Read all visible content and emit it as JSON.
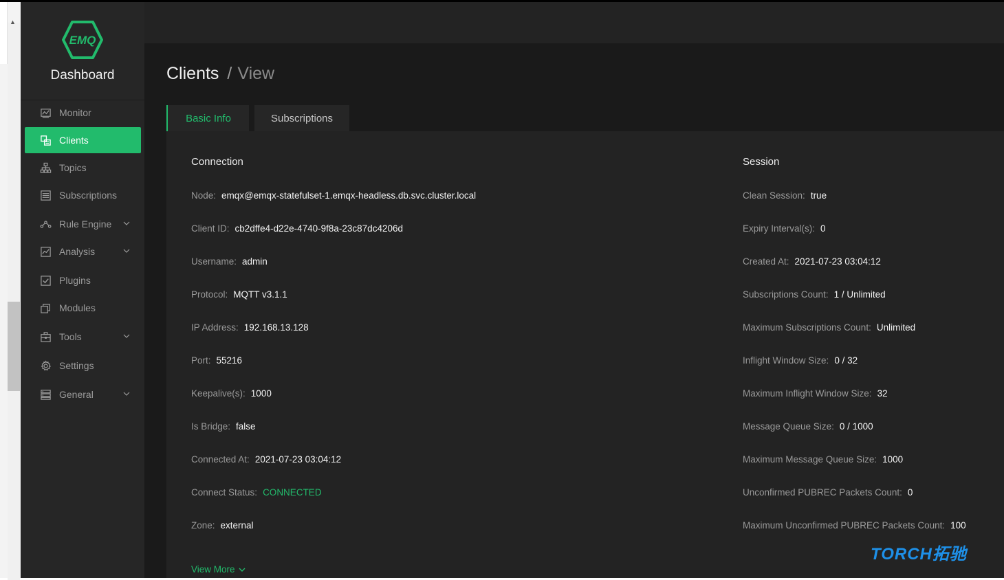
{
  "brand": {
    "logo_text": "EMQ",
    "title": "Dashboard"
  },
  "sidebar": {
    "items": [
      {
        "label": "Monitor",
        "icon": "monitor-icon",
        "active": false,
        "expandable": false
      },
      {
        "label": "Clients",
        "icon": "clients-icon",
        "active": true,
        "expandable": false
      },
      {
        "label": "Topics",
        "icon": "topics-icon",
        "active": false,
        "expandable": false
      },
      {
        "label": "Subscriptions",
        "icon": "subscriptions-icon",
        "active": false,
        "expandable": false
      },
      {
        "label": "Rule Engine",
        "icon": "rule-engine-icon",
        "active": false,
        "expandable": true
      },
      {
        "label": "Analysis",
        "icon": "analysis-icon",
        "active": false,
        "expandable": true
      },
      {
        "label": "Plugins",
        "icon": "plugins-icon",
        "active": false,
        "expandable": false
      },
      {
        "label": "Modules",
        "icon": "modules-icon",
        "active": false,
        "expandable": false
      },
      {
        "label": "Tools",
        "icon": "tools-icon",
        "active": false,
        "expandable": true
      },
      {
        "label": "Settings",
        "icon": "settings-icon",
        "active": false,
        "expandable": false
      },
      {
        "label": "General",
        "icon": "general-icon",
        "active": false,
        "expandable": true
      }
    ]
  },
  "breadcrumb": {
    "first": "Clients",
    "separator": "/",
    "last": "View"
  },
  "tabs": [
    {
      "label": "Basic Info",
      "active": true
    },
    {
      "label": "Subscriptions",
      "active": false
    }
  ],
  "connection": {
    "title": "Connection",
    "rows": [
      {
        "label": "Node:",
        "value": "emqx@emqx-statefulset-1.emqx-headless.db.svc.cluster.local"
      },
      {
        "label": "Client ID:",
        "value": "cb2dffe4-d22e-4740-9f8a-23c87dc4206d"
      },
      {
        "label": "Username:",
        "value": "admin"
      },
      {
        "label": "Protocol:",
        "value": "MQTT v3.1.1"
      },
      {
        "label": "IP Address:",
        "value": "192.168.13.128"
      },
      {
        "label": "Port:",
        "value": "55216"
      },
      {
        "label": "Keepalive(s):",
        "value": "1000"
      },
      {
        "label": "Is Bridge:",
        "value": "false"
      },
      {
        "label": "Connected At:",
        "value": "2021-07-23 03:04:12"
      },
      {
        "label": "Connect Status:",
        "value": "CONNECTED"
      },
      {
        "label": "Zone:",
        "value": "external"
      }
    ]
  },
  "session": {
    "title": "Session",
    "rows": [
      {
        "label": "Clean Session:",
        "value": "true"
      },
      {
        "label": "Expiry Interval(s):",
        "value": "0"
      },
      {
        "label": "Created At:",
        "value": "2021-07-23 03:04:12"
      },
      {
        "label": "Subscriptions Count:",
        "value": "1 / Unlimited"
      },
      {
        "label": "Maximum Subscriptions Count:",
        "value": "Unlimited"
      },
      {
        "label": "Inflight Window Size:",
        "value": "0 / 32"
      },
      {
        "label": "Maximum Inflight Window Size:",
        "value": "32"
      },
      {
        "label": "Message Queue Size:",
        "value": "0 / 1000"
      },
      {
        "label": "Maximum Message Queue Size:",
        "value": "1000"
      },
      {
        "label": "Unconfirmed PUBREC Packets Count:",
        "value": "0"
      },
      {
        "label": "Maximum Unconfirmed PUBREC Packets Count:",
        "value": "100"
      }
    ]
  },
  "view_more": "View More",
  "watermark": "TORCH拓驰",
  "colors": {
    "accent": "#22bb6c",
    "sidebar_bg": "#262626",
    "content_bg": "#1a1a1a",
    "watermark": "#1e90e8"
  }
}
